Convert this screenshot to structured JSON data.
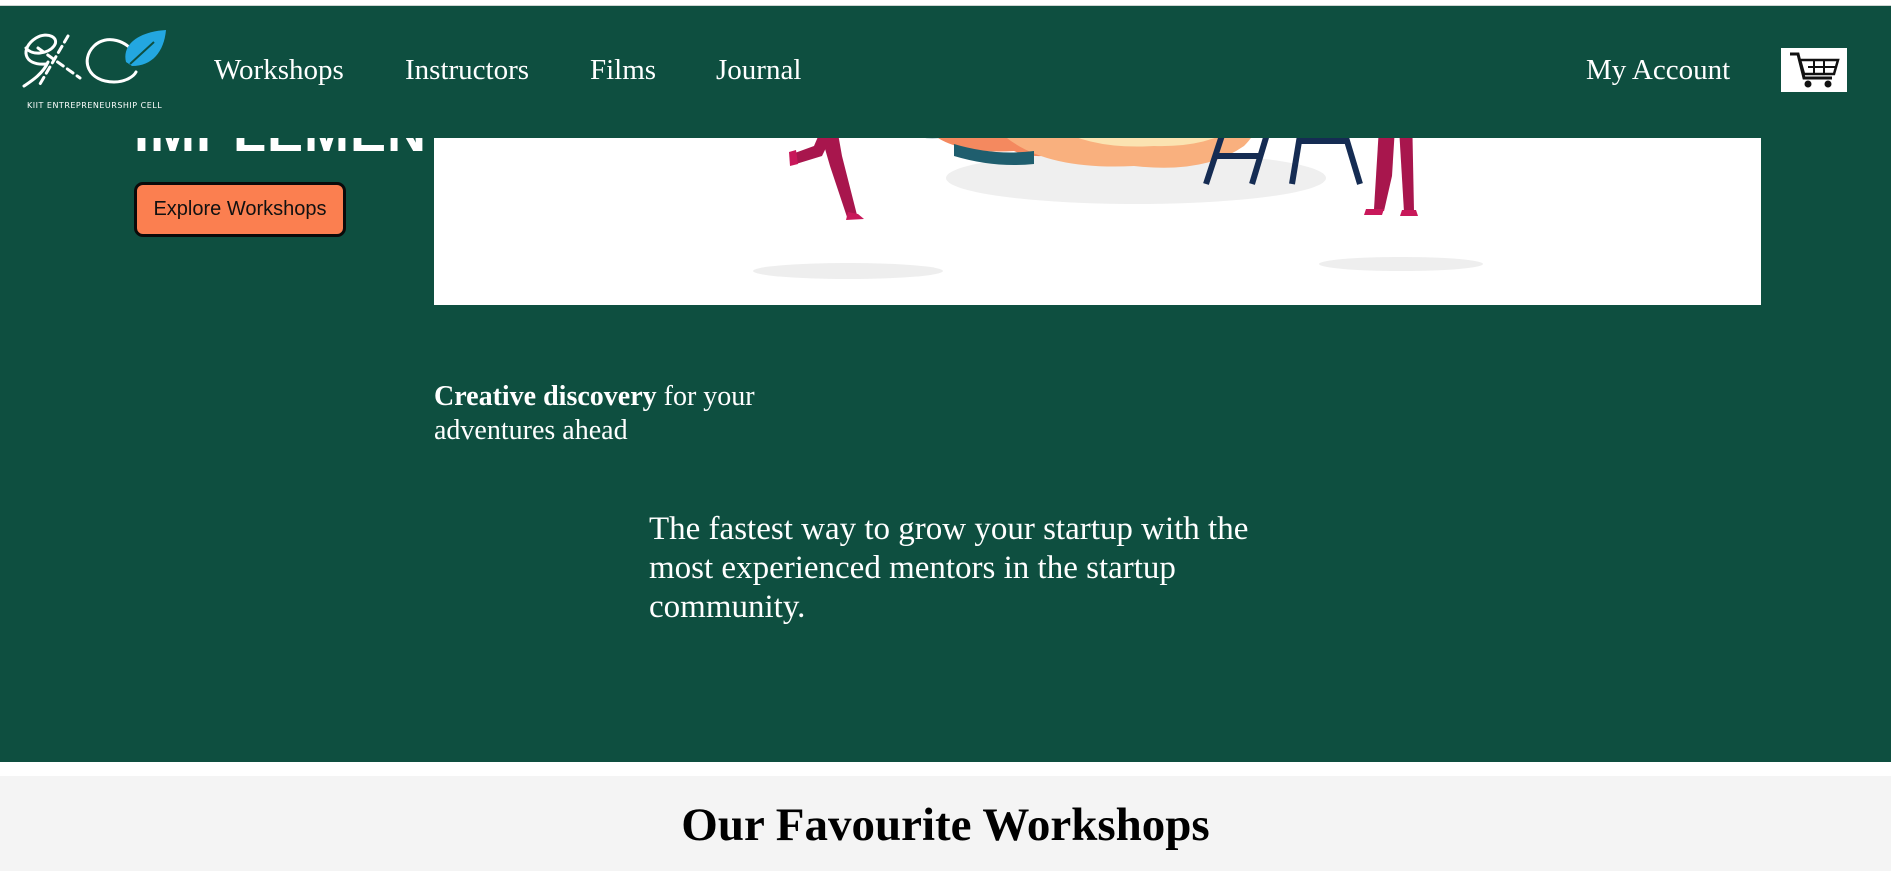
{
  "header": {
    "logo_subtitle": "KIIT ENTREPRENEURSHIP CELL",
    "nav": [
      "Workshops",
      "Instructors",
      "Films",
      "Journal"
    ],
    "account_label": "My Account",
    "cart_icon": "cart-icon"
  },
  "hero": {
    "heading": "IMPLEMENT",
    "cta_label": "Explore Workshops",
    "tagline_bold": "Creative discovery",
    "tagline_rest": " for your adventures ahead",
    "description": "The fastest way to grow your startup with the most experienced mentors in the startup community."
  },
  "section": {
    "title": "Our Favourite Workshops"
  },
  "colors": {
    "brand_green": "#0e4f40",
    "cta_orange": "#fb7f50",
    "leaf_blue": "#23a7e0"
  }
}
